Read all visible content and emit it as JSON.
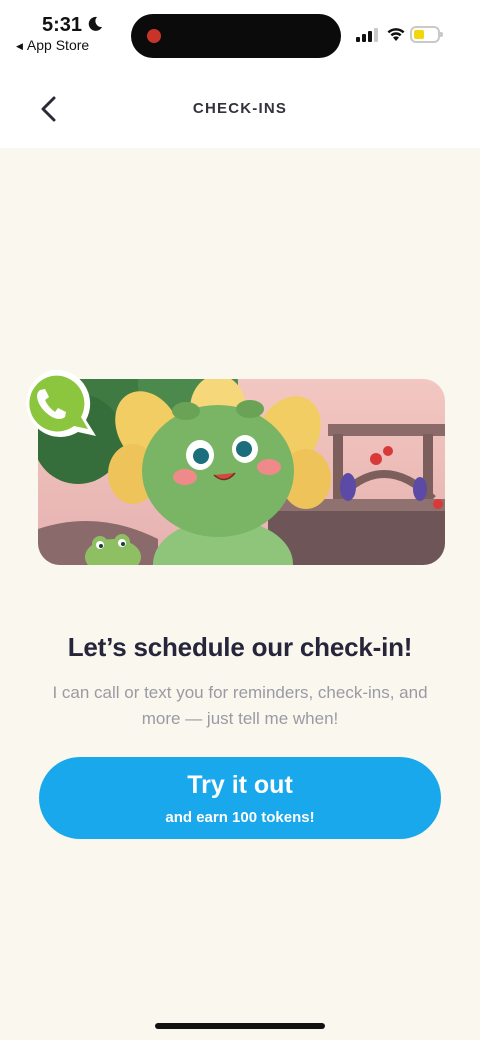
{
  "status_bar": {
    "time": "5:31",
    "back_app": "App Store",
    "icons": [
      "moon-icon",
      "signal-icon",
      "wifi-icon",
      "battery-icon"
    ],
    "battery_level": 0.4,
    "battery_color": "#f4d60a"
  },
  "nav": {
    "title": "CHECK-INS",
    "back_icon": "chevron-left-icon"
  },
  "hero": {
    "badge_icon": "phone-icon",
    "badge_color": "#8cc63f"
  },
  "content": {
    "headline": "Let’s schedule our check-in!",
    "subtext": "I can call or text you for reminders, check-ins, and more — just tell me when!"
  },
  "cta": {
    "title": "Try it out",
    "subtitle": "and earn 100 tokens!",
    "color": "#1aa8ec"
  },
  "colors": {
    "background": "#faf7ef",
    "header": "#ffffff",
    "headline": "#26253a",
    "subtext": "#9a9aa3"
  }
}
